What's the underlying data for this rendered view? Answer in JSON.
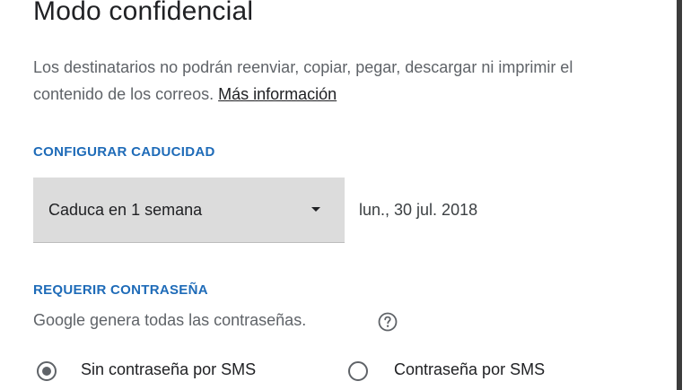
{
  "dialog": {
    "title": "Modo confidencial",
    "description": "Los destinatarios no podrán reenviar, copiar, pegar, descargar ni imprimir el contenido de los correos.",
    "more_info_link": "Más información"
  },
  "expiry": {
    "heading": "CONFIGURAR CADUCIDAD",
    "select_value": "Caduca en 1 semana",
    "date": "lun., 30 jul. 2018"
  },
  "password": {
    "heading": "REQUERIR CONTRASEÑA",
    "note": "Google genera todas las contraseñas.",
    "options": [
      {
        "label": "Sin contraseña por SMS",
        "selected": true
      },
      {
        "label": "Contraseña por SMS",
        "selected": false
      }
    ]
  },
  "icons": {
    "dropdown": "chevron-down-icon",
    "help": "help-icon"
  },
  "colors": {
    "heading": "#1e6bb8",
    "select_background": "#dcdcdc"
  }
}
